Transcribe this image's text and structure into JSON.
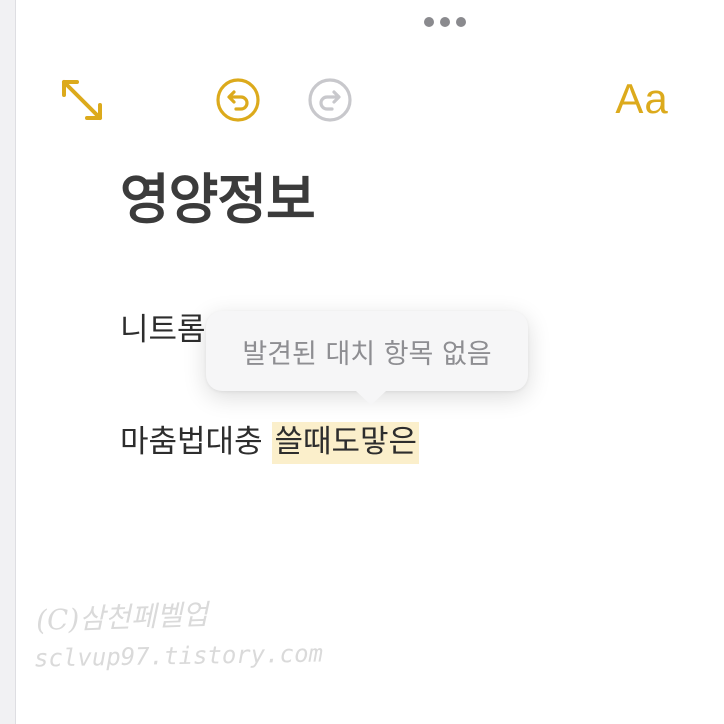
{
  "toolbar": {
    "more_icon": "ellipsis-handle-icon",
    "expand_icon": "expand-arrows-icon",
    "undo_icon": "undo-icon",
    "redo_icon": "redo-icon",
    "format_label": "Aa"
  },
  "note": {
    "title": "영양정보",
    "line1_text": "니트롬",
    "line2_text": "마춤법대충 ",
    "line2_highlight": "쓸때도맣은"
  },
  "popover": {
    "message": "발견된 대치 항목 없음"
  },
  "watermark": {
    "line1": "(C)삼천페벨업",
    "line2": "sclvup97.tistory.com"
  },
  "colors": {
    "accent": "#dcaa1c",
    "disabled": "#c8c8cc",
    "highlight": "#fbefcb",
    "text": "#2d2d2d"
  }
}
